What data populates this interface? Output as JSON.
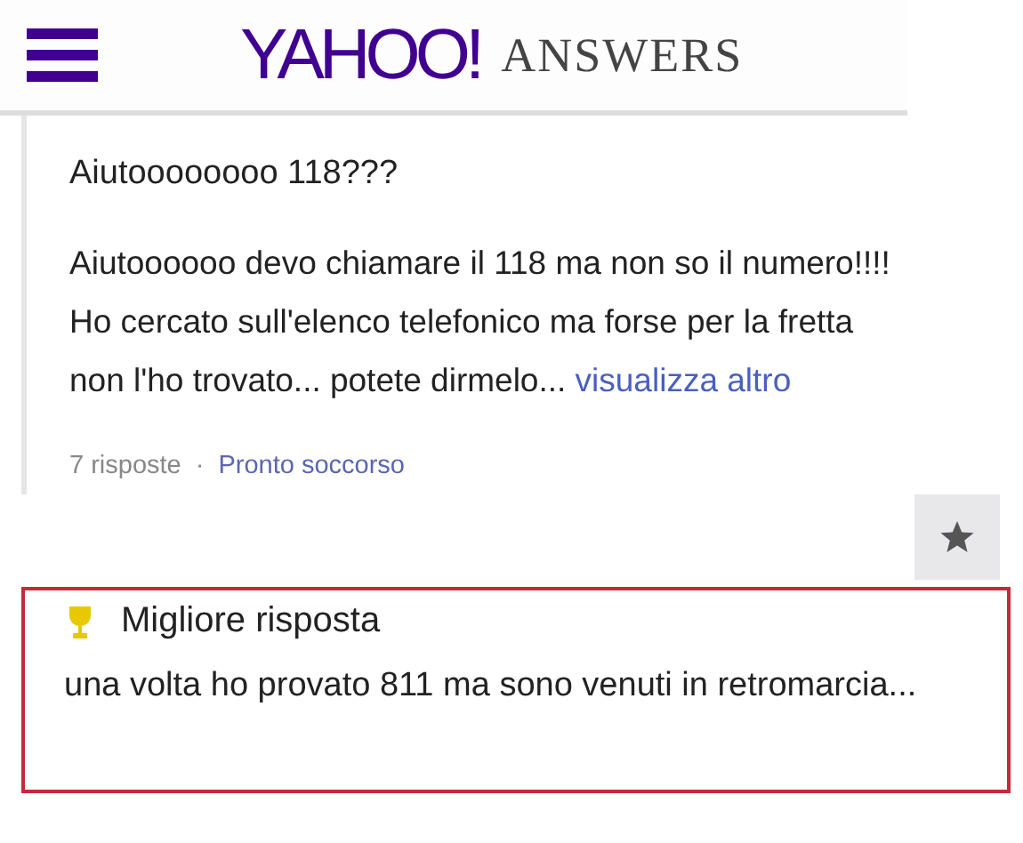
{
  "header": {
    "logo": "YAHOO!",
    "section": "ANSWERS"
  },
  "question": {
    "title": "Aiutoooooooo 118???",
    "body": "Aiutoooooo devo chiamare il 118 ma non so il numero!!!! Ho cercato sull'elenco telefonico ma forse per la fretta non l'ho trovato... potete dirmelo...",
    "more_link": "visualizza altro",
    "answer_count": "7 risposte",
    "separator": "·",
    "category": "Pronto soccorso"
  },
  "best_answer": {
    "label": "Migliore risposta",
    "text": "una volta ho provato 811 ma sono venuti in retromarcia..."
  }
}
